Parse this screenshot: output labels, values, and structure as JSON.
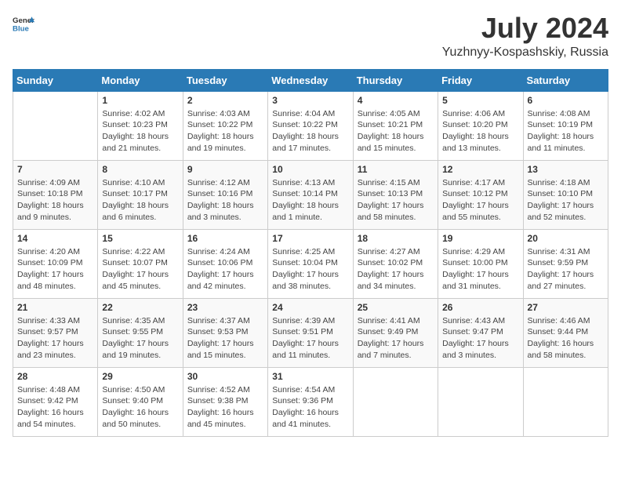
{
  "header": {
    "logo_general": "General",
    "logo_blue": "Blue",
    "month_year": "July 2024",
    "location": "Yuzhnyy-Kospashskiy, Russia"
  },
  "days_of_week": [
    "Sunday",
    "Monday",
    "Tuesday",
    "Wednesday",
    "Thursday",
    "Friday",
    "Saturday"
  ],
  "weeks": [
    [
      {
        "day": "",
        "sunrise": "",
        "sunset": "",
        "daylight": ""
      },
      {
        "day": "1",
        "sunrise": "Sunrise: 4:02 AM",
        "sunset": "Sunset: 10:23 PM",
        "daylight": "Daylight: 18 hours and 21 minutes."
      },
      {
        "day": "2",
        "sunrise": "Sunrise: 4:03 AM",
        "sunset": "Sunset: 10:22 PM",
        "daylight": "Daylight: 18 hours and 19 minutes."
      },
      {
        "day": "3",
        "sunrise": "Sunrise: 4:04 AM",
        "sunset": "Sunset: 10:22 PM",
        "daylight": "Daylight: 18 hours and 17 minutes."
      },
      {
        "day": "4",
        "sunrise": "Sunrise: 4:05 AM",
        "sunset": "Sunset: 10:21 PM",
        "daylight": "Daylight: 18 hours and 15 minutes."
      },
      {
        "day": "5",
        "sunrise": "Sunrise: 4:06 AM",
        "sunset": "Sunset: 10:20 PM",
        "daylight": "Daylight: 18 hours and 13 minutes."
      },
      {
        "day": "6",
        "sunrise": "Sunrise: 4:08 AM",
        "sunset": "Sunset: 10:19 PM",
        "daylight": "Daylight: 18 hours and 11 minutes."
      }
    ],
    [
      {
        "day": "7",
        "sunrise": "Sunrise: 4:09 AM",
        "sunset": "Sunset: 10:18 PM",
        "daylight": "Daylight: 18 hours and 9 minutes."
      },
      {
        "day": "8",
        "sunrise": "Sunrise: 4:10 AM",
        "sunset": "Sunset: 10:17 PM",
        "daylight": "Daylight: 18 hours and 6 minutes."
      },
      {
        "day": "9",
        "sunrise": "Sunrise: 4:12 AM",
        "sunset": "Sunset: 10:16 PM",
        "daylight": "Daylight: 18 hours and 3 minutes."
      },
      {
        "day": "10",
        "sunrise": "Sunrise: 4:13 AM",
        "sunset": "Sunset: 10:14 PM",
        "daylight": "Daylight: 18 hours and 1 minute."
      },
      {
        "day": "11",
        "sunrise": "Sunrise: 4:15 AM",
        "sunset": "Sunset: 10:13 PM",
        "daylight": "Daylight: 17 hours and 58 minutes."
      },
      {
        "day": "12",
        "sunrise": "Sunrise: 4:17 AM",
        "sunset": "Sunset: 10:12 PM",
        "daylight": "Daylight: 17 hours and 55 minutes."
      },
      {
        "day": "13",
        "sunrise": "Sunrise: 4:18 AM",
        "sunset": "Sunset: 10:10 PM",
        "daylight": "Daylight: 17 hours and 52 minutes."
      }
    ],
    [
      {
        "day": "14",
        "sunrise": "Sunrise: 4:20 AM",
        "sunset": "Sunset: 10:09 PM",
        "daylight": "Daylight: 17 hours and 48 minutes."
      },
      {
        "day": "15",
        "sunrise": "Sunrise: 4:22 AM",
        "sunset": "Sunset: 10:07 PM",
        "daylight": "Daylight: 17 hours and 45 minutes."
      },
      {
        "day": "16",
        "sunrise": "Sunrise: 4:24 AM",
        "sunset": "Sunset: 10:06 PM",
        "daylight": "Daylight: 17 hours and 42 minutes."
      },
      {
        "day": "17",
        "sunrise": "Sunrise: 4:25 AM",
        "sunset": "Sunset: 10:04 PM",
        "daylight": "Daylight: 17 hours and 38 minutes."
      },
      {
        "day": "18",
        "sunrise": "Sunrise: 4:27 AM",
        "sunset": "Sunset: 10:02 PM",
        "daylight": "Daylight: 17 hours and 34 minutes."
      },
      {
        "day": "19",
        "sunrise": "Sunrise: 4:29 AM",
        "sunset": "Sunset: 10:00 PM",
        "daylight": "Daylight: 17 hours and 31 minutes."
      },
      {
        "day": "20",
        "sunrise": "Sunrise: 4:31 AM",
        "sunset": "Sunset: 9:59 PM",
        "daylight": "Daylight: 17 hours and 27 minutes."
      }
    ],
    [
      {
        "day": "21",
        "sunrise": "Sunrise: 4:33 AM",
        "sunset": "Sunset: 9:57 PM",
        "daylight": "Daylight: 17 hours and 23 minutes."
      },
      {
        "day": "22",
        "sunrise": "Sunrise: 4:35 AM",
        "sunset": "Sunset: 9:55 PM",
        "daylight": "Daylight: 17 hours and 19 minutes."
      },
      {
        "day": "23",
        "sunrise": "Sunrise: 4:37 AM",
        "sunset": "Sunset: 9:53 PM",
        "daylight": "Daylight: 17 hours and 15 minutes."
      },
      {
        "day": "24",
        "sunrise": "Sunrise: 4:39 AM",
        "sunset": "Sunset: 9:51 PM",
        "daylight": "Daylight: 17 hours and 11 minutes."
      },
      {
        "day": "25",
        "sunrise": "Sunrise: 4:41 AM",
        "sunset": "Sunset: 9:49 PM",
        "daylight": "Daylight: 17 hours and 7 minutes."
      },
      {
        "day": "26",
        "sunrise": "Sunrise: 4:43 AM",
        "sunset": "Sunset: 9:47 PM",
        "daylight": "Daylight: 17 hours and 3 minutes."
      },
      {
        "day": "27",
        "sunrise": "Sunrise: 4:46 AM",
        "sunset": "Sunset: 9:44 PM",
        "daylight": "Daylight: 16 hours and 58 minutes."
      }
    ],
    [
      {
        "day": "28",
        "sunrise": "Sunrise: 4:48 AM",
        "sunset": "Sunset: 9:42 PM",
        "daylight": "Daylight: 16 hours and 54 minutes."
      },
      {
        "day": "29",
        "sunrise": "Sunrise: 4:50 AM",
        "sunset": "Sunset: 9:40 PM",
        "daylight": "Daylight: 16 hours and 50 minutes."
      },
      {
        "day": "30",
        "sunrise": "Sunrise: 4:52 AM",
        "sunset": "Sunset: 9:38 PM",
        "daylight": "Daylight: 16 hours and 45 minutes."
      },
      {
        "day": "31",
        "sunrise": "Sunrise: 4:54 AM",
        "sunset": "Sunset: 9:36 PM",
        "daylight": "Daylight: 16 hours and 41 minutes."
      },
      {
        "day": "",
        "sunrise": "",
        "sunset": "",
        "daylight": ""
      },
      {
        "day": "",
        "sunrise": "",
        "sunset": "",
        "daylight": ""
      },
      {
        "day": "",
        "sunrise": "",
        "sunset": "",
        "daylight": ""
      }
    ]
  ]
}
